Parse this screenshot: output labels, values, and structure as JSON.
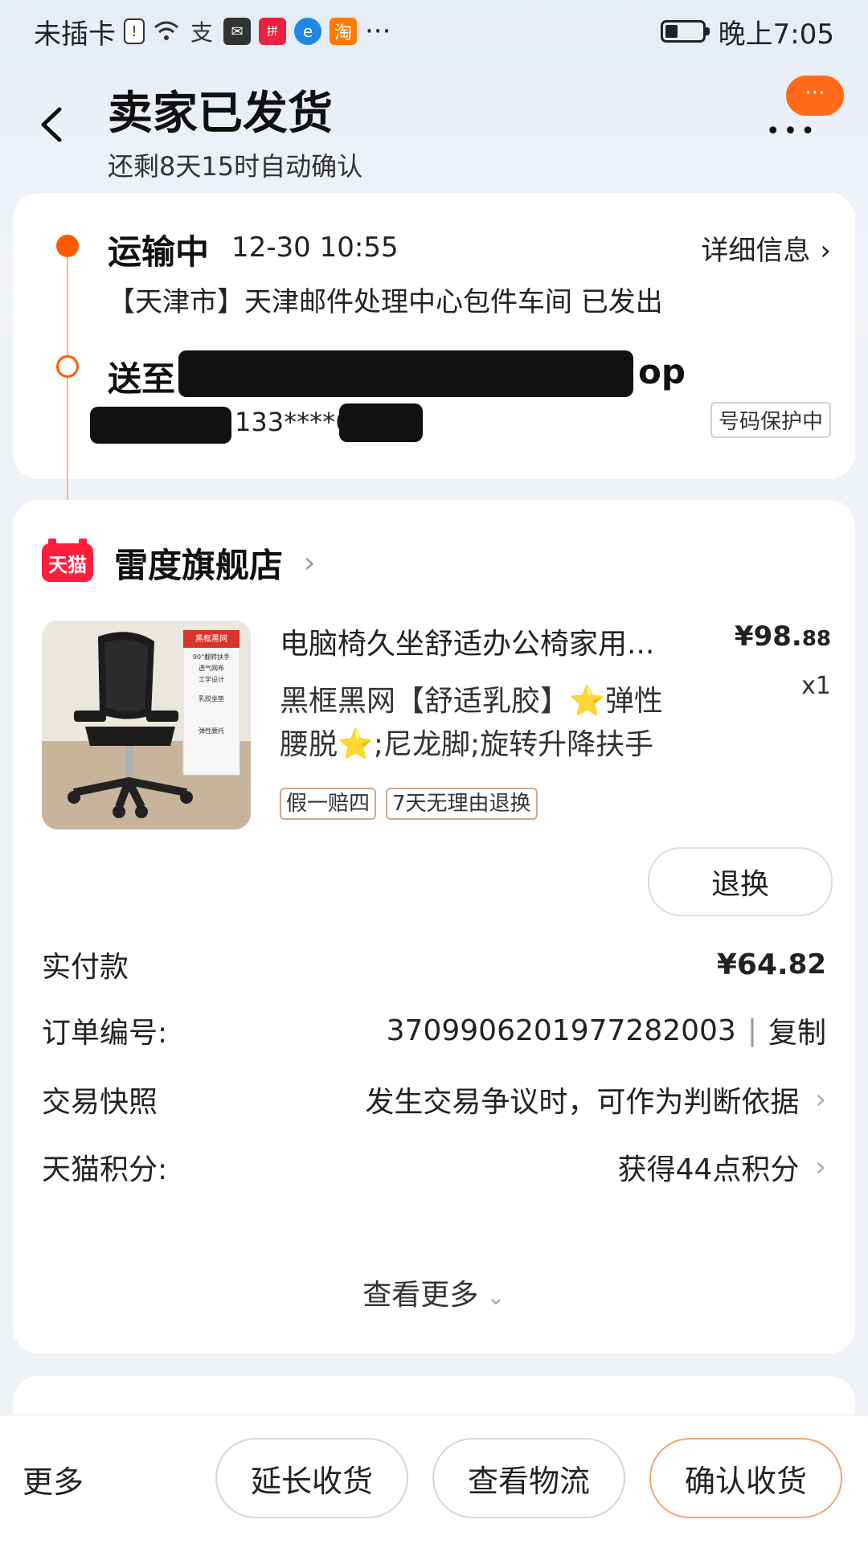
{
  "status_bar": {
    "carrier": "未插卡",
    "time": "晚上7:05",
    "battery_level": 0.35,
    "app_icons": [
      "sim-alert-icon",
      "wifi-icon",
      "alipay-icon",
      "mail-icon",
      "pinduoduo-icon",
      "browser-icon",
      "taobao-icon",
      "more-dots-icon"
    ],
    "more": "···"
  },
  "header": {
    "title": "卖家已发货",
    "subtitle": "还剩8天15时自动确认",
    "back_icon": "chevron-left-icon",
    "more_label": "···",
    "more_dots": "•••"
  },
  "shipping": {
    "status": "运输中",
    "time": "12-30 10:55",
    "detail_link": "详细信息",
    "message": "【天津市】天津邮件处理中心包件车间 已发出",
    "deliver_prefix": "送至 莞",
    "deliver_tail": "op",
    "phone": "133****6",
    "protect_badge": "号码保护中"
  },
  "order": {
    "store_logo": "天猫",
    "store_name": "雷度旗舰店",
    "product": {
      "title": "电脑椅久坐舒适办公椅家用...",
      "price_int": "¥98.",
      "price_dec": "88",
      "qty": "x1",
      "sku_line1": "黑框黑网【舒适乳胶】⭐弹性",
      "sku_line2": "腰脱⭐;尼龙脚;旋转升降扶手",
      "tags": [
        "假一赔四",
        "7天无理由退换"
      ],
      "image_labels": [
        "黑框黑网",
        "90°翻转扶手",
        "透气网布",
        "工学设计",
        "乳胶坐垫",
        "弹性腰托"
      ]
    },
    "refund_button": "退换",
    "paid": {
      "label": "实付款",
      "value_int": "¥64.",
      "value_dec": "82"
    },
    "order_no": {
      "label": "订单编号:",
      "value": "3709906201977282003",
      "copy": "复制"
    },
    "snapshot": {
      "label": "交易快照",
      "value": "发生交易争议时，可作为判断依据"
    },
    "points": {
      "label": "天猫积分:",
      "value": "获得44点积分"
    },
    "see_more": "查看更多"
  },
  "bottom_bar": {
    "more": "更多",
    "extend": "延长收货",
    "logistics": "查看物流",
    "confirm": "确认收货"
  },
  "colors": {
    "accent": "#ff5a00",
    "tmall_red": "#ff1f3d"
  }
}
